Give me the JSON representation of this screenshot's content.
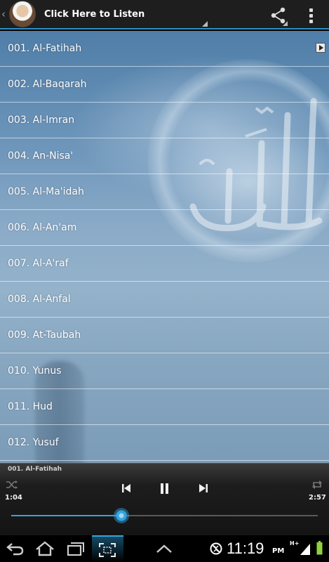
{
  "header": {
    "title": "Click Here to Listen",
    "back_icon": "chevron-left-icon",
    "avatar": "reciter-avatar",
    "share_icon": "share-icon",
    "overflow_icon": "overflow-menu-icon"
  },
  "suras": [
    {
      "label": "001. Al-Fatihah",
      "playing": true
    },
    {
      "label": "002. Al-Baqarah"
    },
    {
      "label": "003. Al-Imran"
    },
    {
      "label": "004. An-Nisa'"
    },
    {
      "label": "005. Al-Ma'idah"
    },
    {
      "label": "006. Al-An'am"
    },
    {
      "label": "007. Al-A'raf"
    },
    {
      "label": "008. Al-Anfal"
    },
    {
      "label": "009. At-Taubah"
    },
    {
      "label": "010. Yunus"
    },
    {
      "label": "011. Hud"
    },
    {
      "label": "012. Yusuf"
    }
  ],
  "player": {
    "now_playing": "001. Al-Fatihah",
    "elapsed": "1:04",
    "total": "2:57",
    "progress": 0.36,
    "state": "playing",
    "accent": "#33a4e0"
  },
  "statusbar": {
    "time": "11:19",
    "ampm": "PM",
    "network": "H+"
  }
}
